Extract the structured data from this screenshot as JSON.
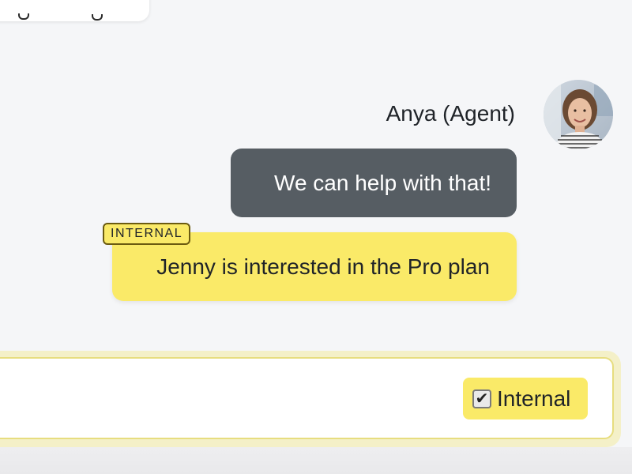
{
  "previous_message": {
    "partial_text": ""
  },
  "agent": {
    "name": "Anya (Agent)",
    "avatar_icon": "user-photo"
  },
  "messages": [
    {
      "kind": "agent",
      "text": "We can help with that!"
    },
    {
      "kind": "internal",
      "tag": "INTERNAL",
      "text": "Jenny is interested in the Pro plan"
    }
  ],
  "composer": {
    "value": "",
    "placeholder": "",
    "internal_toggle": {
      "label": "Internal",
      "checked": true,
      "check_glyph": "✔"
    }
  },
  "colors": {
    "background": "#f5f6f8",
    "agent_bubble": "#565d63",
    "internal_highlight": "#faea68",
    "tag_border": "#6b5b10"
  }
}
